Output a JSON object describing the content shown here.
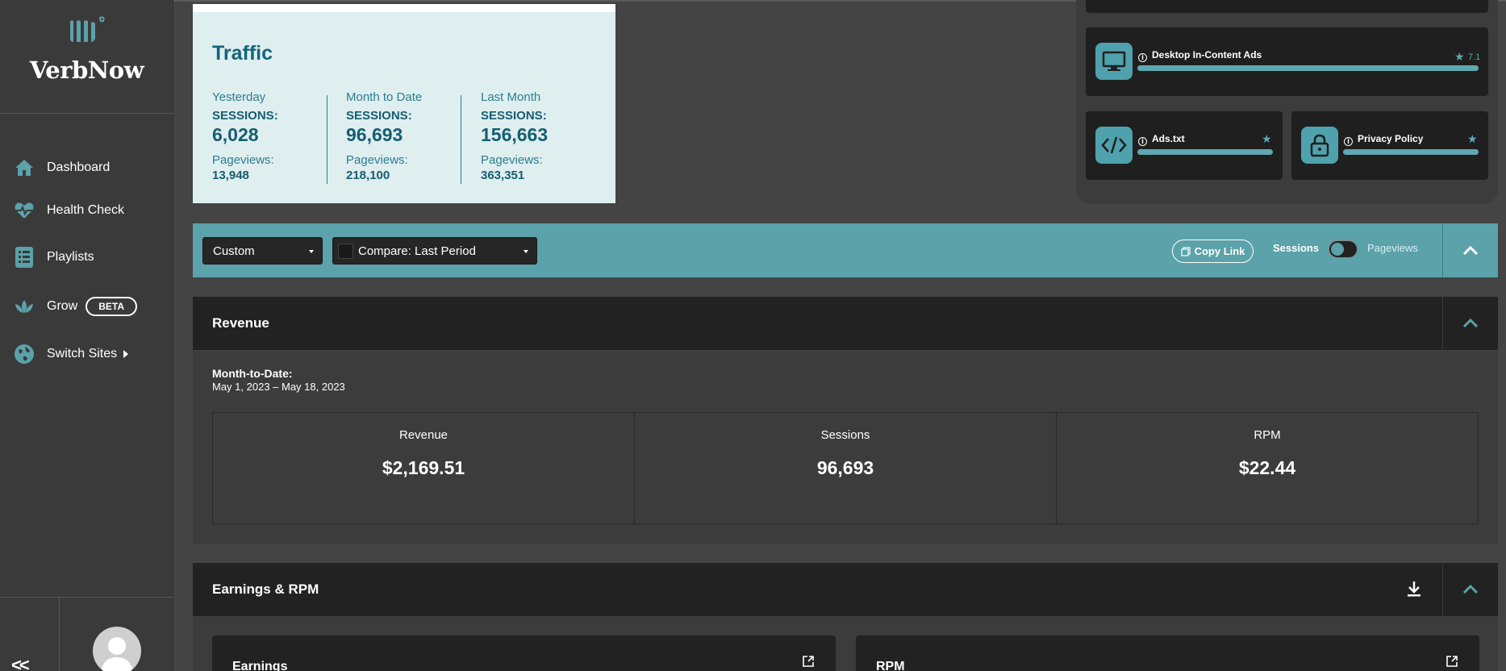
{
  "sidebar": {
    "brand": "VerbNow",
    "items": [
      {
        "label": "Dashboard",
        "icon": "home-icon"
      },
      {
        "label": "Health Check",
        "icon": "heartbeat-icon"
      },
      {
        "label": "Playlists",
        "icon": "list-icon"
      },
      {
        "label": "Grow",
        "icon": "lotus-icon",
        "badge": "BETA"
      },
      {
        "label": "Switch Sites",
        "icon": "globe-icon"
      }
    ],
    "collapse_label": "<<"
  },
  "traffic": {
    "title": "Traffic",
    "columns": [
      {
        "label": "Yesterday",
        "sessions_label": "SESSIONS:",
        "sessions": "6,028",
        "pageviews_label": "Pageviews:",
        "pageviews": "13,948"
      },
      {
        "label": "Month to Date",
        "sessions_label": "SESSIONS:",
        "sessions": "96,693",
        "pageviews_label": "Pageviews:",
        "pageviews": "218,100"
      },
      {
        "label": "Last Month",
        "sessions_label": "SESSIONS:",
        "sessions": "156,663",
        "pageviews_label": "Pageviews:",
        "pageviews": "363,351"
      }
    ]
  },
  "health_cards": {
    "desktop": {
      "title": "Desktop In-Content Ads",
      "score": "7.1",
      "icon": "monitor-icon",
      "progress": 1.0
    },
    "ads_txt": {
      "title": "Ads.txt",
      "icon": "code-icon",
      "progress": 1.0
    },
    "privacy": {
      "title": "Privacy Policy",
      "icon": "lock-icon",
      "progress": 1.0
    }
  },
  "filterbar": {
    "range_select": "Custom",
    "compare_select": "Compare: Last Period",
    "copy_link": "Copy Link",
    "toggle_left": "Sessions",
    "toggle_right": "Pageviews"
  },
  "revenue": {
    "title": "Revenue",
    "period_label": "Month-to-Date:",
    "period_range": "May 1, 2023 – May 18, 2023",
    "stats": [
      {
        "label": "Revenue",
        "value": "$2,169.51"
      },
      {
        "label": "Sessions",
        "value": "96,693"
      },
      {
        "label": "RPM",
        "value": "$22.44"
      }
    ]
  },
  "earnings": {
    "title": "Earnings & RPM",
    "cards": [
      {
        "title": "Earnings"
      },
      {
        "title": "RPM"
      }
    ]
  },
  "colors": {
    "accent": "#5ba2aa",
    "traffic_bg": "#dfeeef",
    "traffic_text": "#13657a",
    "panel_dark": "#222222"
  }
}
